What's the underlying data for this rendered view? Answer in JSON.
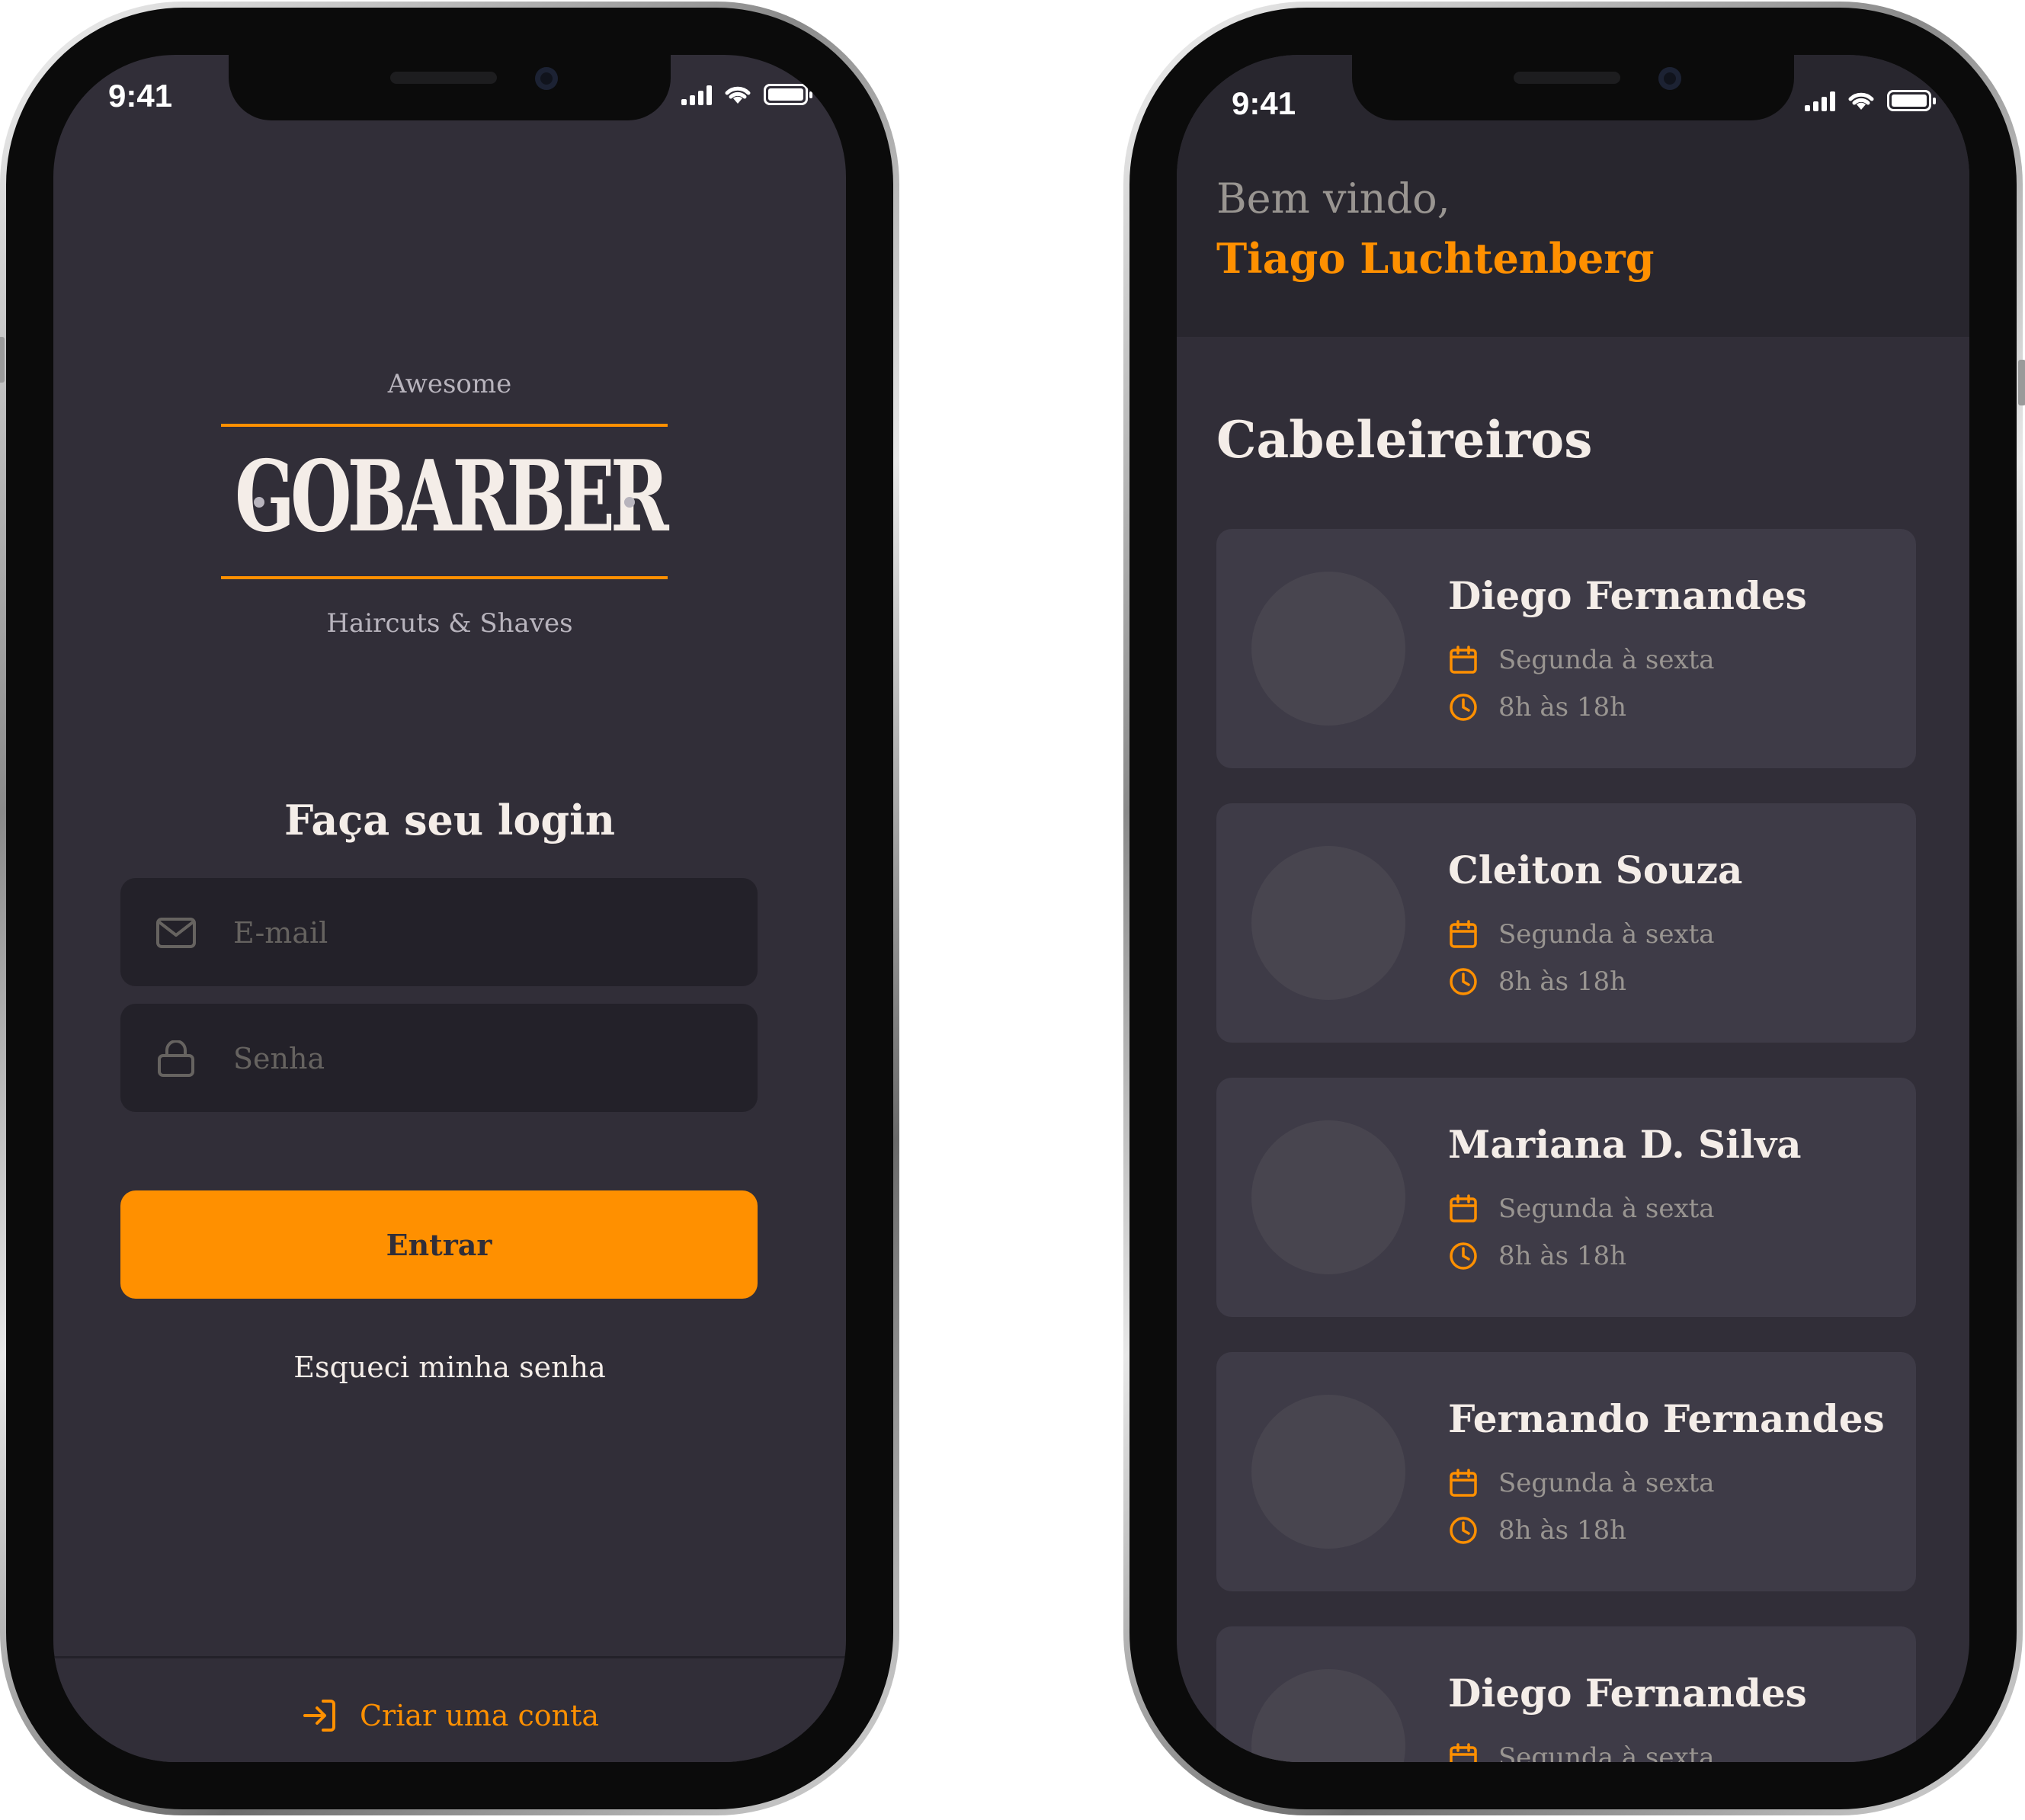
{
  "colors": {
    "accent": "#ff9000",
    "background": "#312e38",
    "input_bg": "#232129",
    "card_bg": "#3e3b47",
    "text_light": "#f4ede8",
    "text_muted": "#999591"
  },
  "status_bar": {
    "left_time": "9:41",
    "right_time": "9:41"
  },
  "login": {
    "logo_top": "Awesome",
    "logo_word": "GOBARBER",
    "logo_bottom": "Haircuts & Shaves",
    "title": "Faça seu login",
    "email_placeholder": "E-mail",
    "password_placeholder": "Senha",
    "submit_label": "Entrar",
    "forgot_label": "Esqueci minha senha",
    "create_account_label": "Criar uma conta"
  },
  "dashboard": {
    "welcome": "Bem vindo,",
    "user_name": "Tiago Luchtenberg",
    "section_title": "Cabeleireiros",
    "providers": [
      {
        "name": "Diego Fernandes",
        "days": "Segunda à sexta",
        "hours": "8h às 18h"
      },
      {
        "name": "Cleiton Souza",
        "days": "Segunda à sexta",
        "hours": "8h às 18h"
      },
      {
        "name": "Mariana D. Silva",
        "days": "Segunda à sexta",
        "hours": "8h às 18h"
      },
      {
        "name": "Fernando Fernandes",
        "days": "Segunda à sexta",
        "hours": "8h às 18h"
      },
      {
        "name": "Diego Fernandes",
        "days": "Segunda à sexta",
        "hours": ""
      }
    ]
  },
  "icons": [
    "mail-icon",
    "lock-icon",
    "log-in-icon",
    "calendar-icon",
    "clock-icon",
    "signal-icon",
    "wifi-icon",
    "battery-icon"
  ]
}
